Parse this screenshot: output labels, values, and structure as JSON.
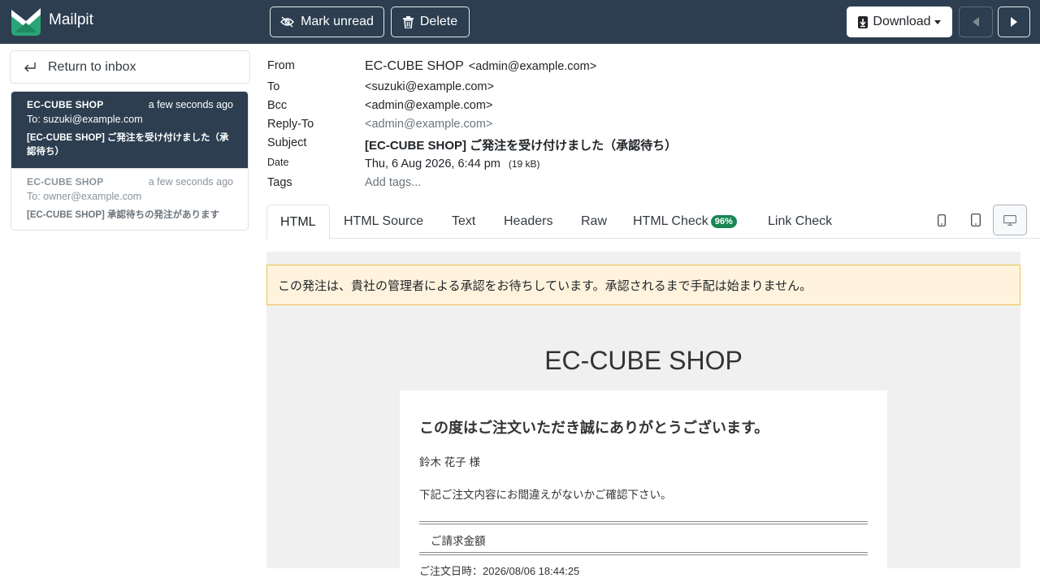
{
  "app": {
    "name": "Mailpit"
  },
  "toolbar": {
    "mark_unread": "Mark unread",
    "delete": "Delete",
    "download": "Download"
  },
  "sidebar": {
    "return_label": "Return to inbox",
    "messages": [
      {
        "from": "EC-CUBE SHOP",
        "date": "a few seconds ago",
        "to": "To: suzuki@example.com",
        "subject": "[EC-CUBE SHOP] ご発注を受け付けました（承認待ち）"
      },
      {
        "from": "EC-CUBE SHOP",
        "date": "a few seconds ago",
        "to": "To: owner@example.com",
        "subject": "[EC-CUBE SHOP] 承認待ちの発注があります"
      }
    ]
  },
  "headers": {
    "from_label": "From",
    "from_name": "EC-CUBE SHOP",
    "from_email": "<admin@example.com>",
    "to_label": "To",
    "to_value": "<suzuki@example.com>",
    "bcc_label": "Bcc",
    "bcc_value": "<admin@example.com>",
    "replyto_label": "Reply-To",
    "replyto_value": "<admin@example.com>",
    "subject_label": "Subject",
    "subject_value": "[EC-CUBE SHOP] ご発注を受け付けました（承認待ち）",
    "date_label": "Date",
    "date_value": "Thu, 6 Aug 2026, 6:44 pm",
    "size": "(19 kB)",
    "tags_label": "Tags",
    "tags_placeholder": "Add tags..."
  },
  "tabs": {
    "html": "HTML",
    "html_source": "HTML Source",
    "text": "Text",
    "headers": "Headers",
    "raw": "Raw",
    "html_check": "HTML Check",
    "html_check_score": "96%",
    "link_check": "Link Check"
  },
  "email": {
    "notice": "この発注は、貴社の管理者による承認をお待ちしています。承認されるまで手配は始まりません。",
    "shop_title": "EC-CUBE SHOP",
    "thanks": "この度はご注文いただき誠にありがとうございます。",
    "customer": "鈴木 花子 様",
    "check": "下記ご注文内容にお間違えがないかご確認下さい。",
    "billing": "ご請求金額",
    "order_date": "ご注文日時：2026/08/06 18:44:25"
  },
  "colors": {
    "topbar": "#2c3e50",
    "notice_bg": "#fff3de",
    "notice_border": "#f0c050",
    "badge": "#198754"
  }
}
